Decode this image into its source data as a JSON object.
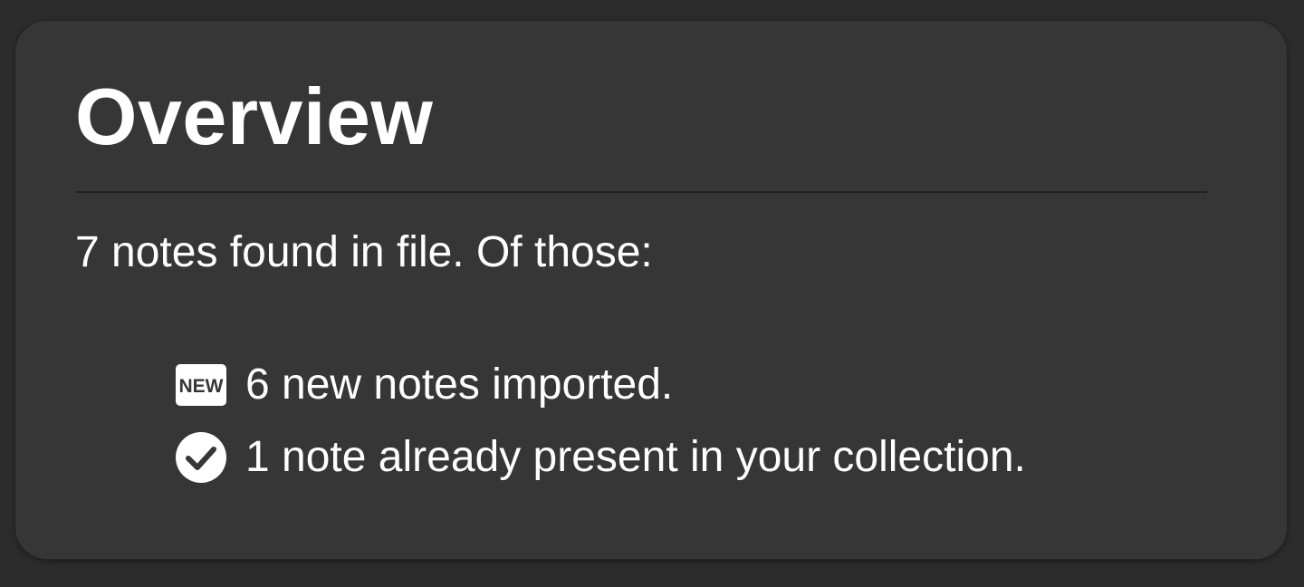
{
  "overview": {
    "title": "Overview",
    "summary": "7 notes found in file. Of those:",
    "items": [
      {
        "icon": "new-badge-icon",
        "label": "6 new notes imported."
      },
      {
        "icon": "check-circle-icon",
        "label": "1 note already present in your collection."
      }
    ]
  },
  "colors": {
    "background": "#2c2c2c",
    "card": "#363636",
    "text": "#ffffff",
    "divider": "#222222"
  }
}
